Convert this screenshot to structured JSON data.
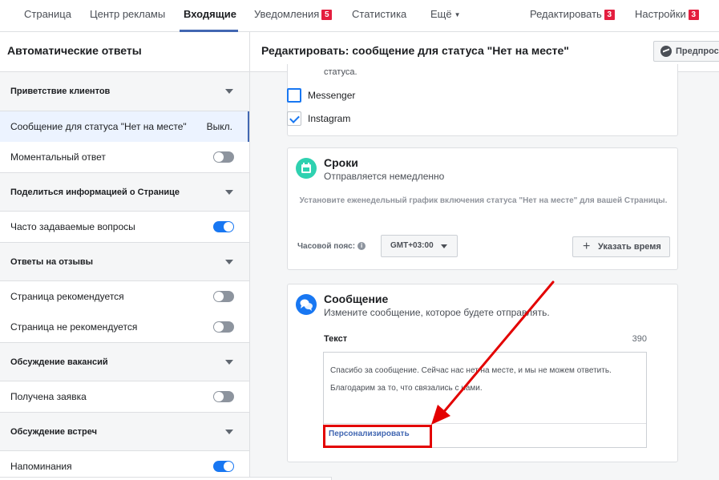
{
  "nav": {
    "items": [
      {
        "label": "Страница"
      },
      {
        "label": "Центр рекламы"
      },
      {
        "label": "Входящие",
        "active": true
      },
      {
        "label": "Уведомления",
        "badge": "5"
      },
      {
        "label": "Статистика"
      },
      {
        "label": "Ещё"
      }
    ],
    "edit_label": "Редактировать",
    "edit_badge": "3",
    "settings_label": "Настройки",
    "settings_badge": "3"
  },
  "sidebar": {
    "title": "Автоматические ответы",
    "sections": [
      {
        "title": "Приветствие клиентов",
        "items": [
          {
            "label": "Сообщение для статуса \"Нет на месте\"",
            "status": "Выкл.",
            "selected": true
          },
          {
            "label": "Моментальный ответ",
            "toggle": "off"
          }
        ]
      },
      {
        "title": "Поделиться информацией о Странице",
        "items": [
          {
            "label": "Часто задаваемые вопросы",
            "toggle": "on"
          }
        ]
      },
      {
        "title": "Ответы на отзывы",
        "items": [
          {
            "label": "Страница рекомендуется",
            "toggle": "off"
          },
          {
            "label": "Страница не рекомендуется",
            "toggle": "off"
          }
        ]
      },
      {
        "title": "Обсуждение вакансий",
        "items": [
          {
            "label": "Получена заявка",
            "toggle": "off"
          }
        ]
      },
      {
        "title": "Обсуждение встреч",
        "items": [
          {
            "label": "Напоминания",
            "toggle": "on"
          }
        ]
      }
    ]
  },
  "main": {
    "title": "Редактировать: сообщение для статуса \"Нет на месте\"",
    "preview_label": "Предпрос",
    "platforms": {
      "cut_text": "статуса.",
      "messenger_label": "Messenger",
      "messenger_checked": false,
      "instagram_label": "Instagram",
      "instagram_checked": true
    },
    "schedule": {
      "title": "Сроки",
      "subtitle": "Отправляется немедленно",
      "description": "Установите еженедельный график включения статуса \"Нет на месте\" для вашей Страницы.",
      "timezone_label": "Часовой пояс:",
      "timezone_value": "GMT+03:00",
      "set_time_label": "Указать время"
    },
    "message": {
      "title": "Сообщение",
      "subtitle": "Измените сообщение, которое будете отправлять.",
      "text_label": "Текст",
      "char_count": "390",
      "text": "Спасибо за сообщение. Сейчас нас нет на месте, и мы не можем ответить. Благодарим за то, что связались с нами.",
      "personalize_label": "Персонализировать"
    }
  },
  "colors": {
    "accent": "#4267b2",
    "toggle_on": "#1877f2",
    "badge": "#e41e3f",
    "annotation": "#e30000",
    "schedule_icon": "#2fd1b0",
    "message_icon": "#1877f2"
  }
}
